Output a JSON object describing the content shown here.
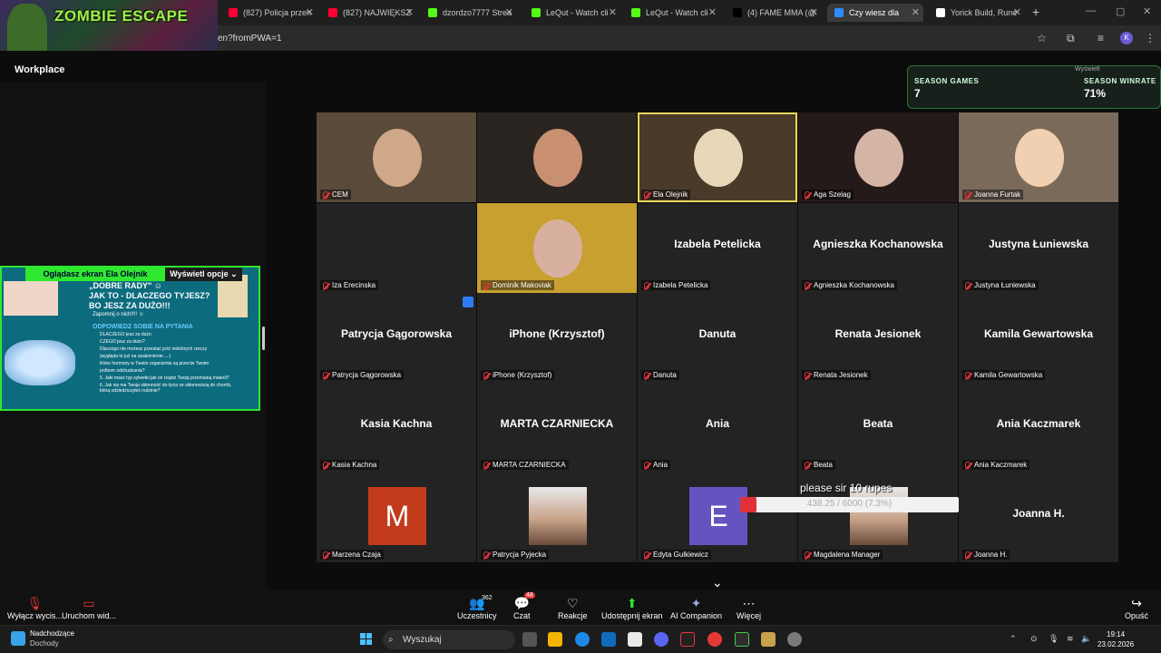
{
  "browser": {
    "tabs": [
      {
        "label": "(827) Policja przen",
        "color": "#ff0033"
      },
      {
        "label": "(827) NAJWIĘKSZ",
        "color": "#ff0033"
      },
      {
        "label": "dzordzo7777 Strea",
        "color": "#53fc18"
      },
      {
        "label": "LeQut - Watch cli",
        "color": "#53fc18"
      },
      {
        "label": "LeQut - Watch cli",
        "color": "#53fc18"
      },
      {
        "label": "(4) FAME MMA (@",
        "color": "#000000"
      },
      {
        "label": "Czy wiesz dla",
        "color": "#2d8cff"
      },
      {
        "label": "Yorick Build, Rune",
        "color": "#ffffff"
      }
    ],
    "url": "en?fromPWA=1",
    "banner_title": "ZOMBIE ESCAPE",
    "profile_initial": "K"
  },
  "zoom": {
    "workspace_label": "Workplace",
    "share": {
      "viewing_label": "Oglądasz ekran  Ela Olejnik",
      "options_label": "Wyświetl opcje",
      "slide_title": "„DOBRE RADY\" ☺\nJAK TO - DLACZEGO TYJESZ?\nBO JESZ ZA DUŻO!!!",
      "slide_sub": "Zapomnij o nich!!!! ☺",
      "slide_question": "ODPOWIEDZ SOBIE NA PYTANIA",
      "slide_lines": [
        "DLACZEGO jesz za dużo",
        "CZEGO jesz za dużo?",
        "Dlaczego nie możesz przestać jeść niektórych rzeczy",
        "(wygląda to już na uzależnienie.....)",
        "Które hormony w Twoim organizmie są przeciw Twoim",
        "próbom odchudzania?",
        "5. Jaki masz typ sylwetki jak on rządzi Twoją przemianą materii?",
        "6. Jak się ma Twoja skłonność do tycia ze skłonnością do chorób, którą odziedziczyłeś rodzinie?"
      ]
    },
    "season": {
      "games_label": "SEASON GAMES",
      "games_value": "7",
      "winrate_label": "SEASON WINRATE",
      "winrate_value": "71%",
      "view_label": "Wyświetl"
    },
    "participants": [
      {
        "label": "CEM",
        "display": "",
        "video": true
      },
      {
        "label": "",
        "display": "",
        "video": true
      },
      {
        "label": "Ela Olejnik",
        "display": "",
        "video": true,
        "speaking": true
      },
      {
        "label": "Aga Szelag",
        "display": "",
        "video": true
      },
      {
        "label": "Joanna Furtak",
        "display": "",
        "video": true
      },
      {
        "label": "Iza Erecinska",
        "display": ""
      },
      {
        "label": "Dominik Makoviak",
        "display": "",
        "video": true
      },
      {
        "label": "Izabela Petelicka",
        "display": "Izabela Petelicka"
      },
      {
        "label": "Agnieszka Kochanowska",
        "display": "Agnieszka Kochanowska"
      },
      {
        "label": "Justyna Łuniewska",
        "display": "Justyna Łuniewska"
      },
      {
        "label": "Patrycja Gągorowska",
        "display": "Patrycja Gągorowska"
      },
      {
        "label": "iPhone (Krzysztof)",
        "display": "iPhone (Krzysztof)"
      },
      {
        "label": "Danuta",
        "display": "Danuta"
      },
      {
        "label": "Renata Jesionek",
        "display": "Renata Jesionek"
      },
      {
        "label": "Kamila Gewartowska",
        "display": "Kamila Gewartowska"
      },
      {
        "label": "Kasia Kachna",
        "display": "Kasia Kachna"
      },
      {
        "label": "MARTA CZARNIECKA",
        "display": "MARTA CZARNIECKA"
      },
      {
        "label": "Ania",
        "display": "Ania"
      },
      {
        "label": "Beata",
        "display": "Beata"
      },
      {
        "label": "Ania Kaczmarek",
        "display": "Ania Kaczmarek"
      },
      {
        "label": "Marzena Czaja",
        "display": "",
        "avatar": "M",
        "avatar_color": "#c23b1b"
      },
      {
        "label": "Patrycja Pyjecka",
        "display": "",
        "photo": true
      },
      {
        "label": "Edyta Gulkiewicz",
        "display": "",
        "avatar": "E",
        "avatar_color": "#6554c0"
      },
      {
        "label": "Magdalena Manager",
        "display": "",
        "photo": true
      },
      {
        "label": "Joanna H.",
        "display": "Joanna H."
      }
    ],
    "donation": {
      "text": "please sir 10 rupes",
      "amount": "438.25 / 6000 (7.3%)",
      "progress_percent": 7.3
    },
    "toolbar": {
      "mute_label": "Wyłącz wycis...",
      "video_label": "Uruchom wid...",
      "participants_label": "Uczestnicy",
      "participants_count": "362",
      "chat_label": "Czat",
      "chat_badge": "48",
      "reactions_label": "Reakcje",
      "share_label": "Udostępnij ekran",
      "ai_label": "AI Companion",
      "more_label": "Więcej",
      "leave_label": "Opuść"
    }
  },
  "taskbar": {
    "weather_line1": "Nadchodzące",
    "weather_line2": "Dochody",
    "search_placeholder": "Wyszukaj",
    "time": "19:14",
    "date": "23.02.2026"
  }
}
